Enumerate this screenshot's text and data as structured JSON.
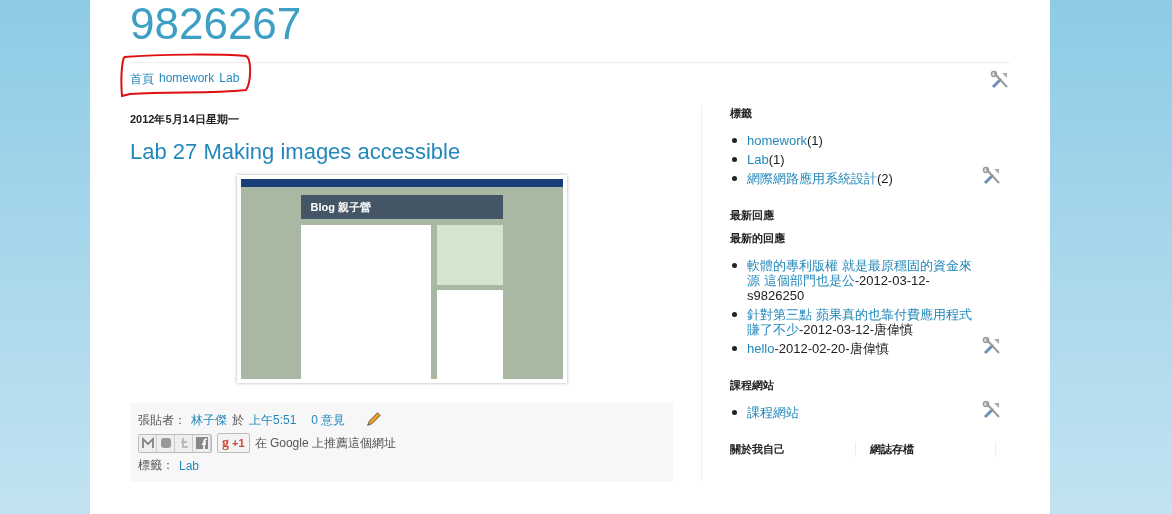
{
  "blog_title": "9826267",
  "nav": {
    "links": [
      "首頁",
      "homework",
      "Lab"
    ],
    "annotated": true
  },
  "post": {
    "date": "2012年5月14日星期一",
    "title": "Lab 27 Making images accessible",
    "screenshot": {
      "blog_name": "Blog 親子營"
    },
    "footer": {
      "posted_by_label": "張貼者：",
      "author": "林子傑",
      "at": "於",
      "time": "上午5:51",
      "comments": "0 意見",
      "plus_icon": "g",
      "plus_one": "+1",
      "recommend": "在 Google 上推薦這個網址",
      "labels_label": "標籤：",
      "label": "Lab"
    }
  },
  "sidebar": {
    "labels": {
      "title": "標籤",
      "items": [
        {
          "name": "homework",
          "count": "(1)"
        },
        {
          "name": "Lab",
          "count": "(1)"
        },
        {
          "name": "網際網路應用系統設計",
          "count": "(2)"
        }
      ]
    },
    "recent_comments": {
      "title": "最新回應",
      "subtitle": "最新的回應",
      "items": [
        {
          "text": "軟體的專利版權 就是最原穩固的資金來源 這個部門也是公",
          "meta": "-2012-03-12-s9826250"
        },
        {
          "text": "針對第三點 蘋果真的也靠付費應用程式賺了不少",
          "meta": "-2012-03-12-唐偉慎"
        },
        {
          "text": "hello",
          "meta": "-2012-02-20-唐偉慎"
        }
      ]
    },
    "course_site": {
      "title": "課程網站",
      "items": [
        "課程網站"
      ]
    },
    "bottom_headings": [
      "關於我自己",
      "網誌存檔"
    ]
  }
}
